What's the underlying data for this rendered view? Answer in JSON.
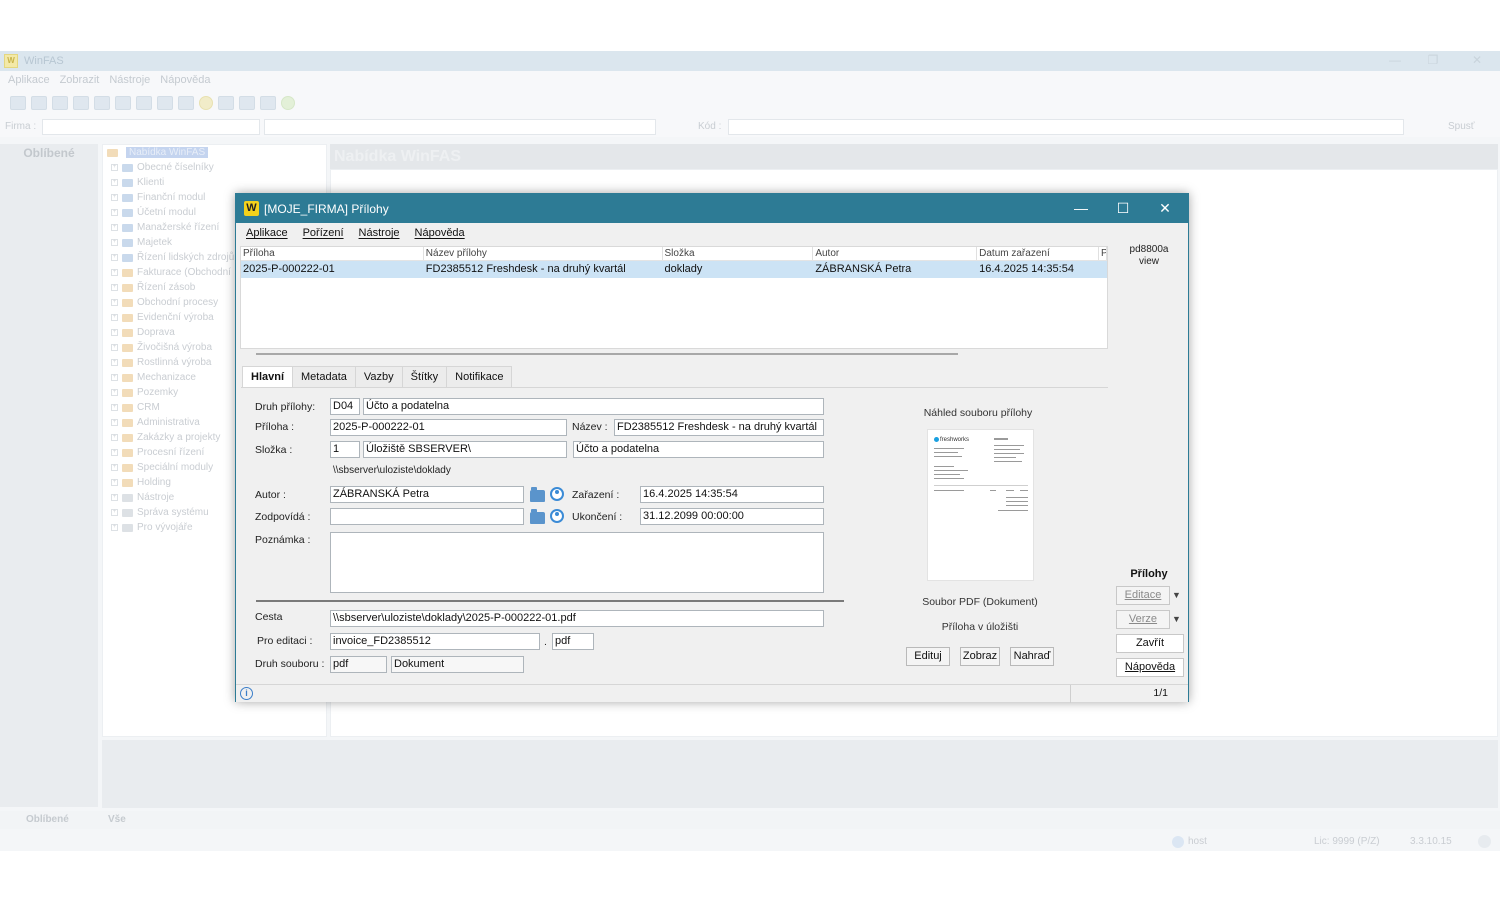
{
  "main_window": {
    "title": "WinFAS",
    "menu": [
      "Aplikace",
      "Zobrazit",
      "Nástroje",
      "Nápověda"
    ],
    "filter_label_firma": "Firma :",
    "filter_label_kod": "Kód :",
    "run_label": "Spusť",
    "sidebar_title": "Oblíbené",
    "tree_root": "Nabídka WinFAS",
    "tree_items": [
      {
        "label": "Obecné číselníky",
        "color": "blue"
      },
      {
        "label": "Klienti",
        "color": "blue"
      },
      {
        "label": "Finanční modul",
        "color": "blue"
      },
      {
        "label": "Účetní modul",
        "color": "blue"
      },
      {
        "label": "Manažerské řízení",
        "color": "blue"
      },
      {
        "label": "Majetek",
        "color": "blue"
      },
      {
        "label": "Řízení lidských zdrojů",
        "color": "blue"
      },
      {
        "label": "Fakturace (Obchodní",
        "color": "orange"
      },
      {
        "label": "Řízení zásob",
        "color": "orange"
      },
      {
        "label": "Obchodní procesy",
        "color": "orange"
      },
      {
        "label": "Evidenční výroba",
        "color": "orange"
      },
      {
        "label": "Doprava",
        "color": "orange"
      },
      {
        "label": "Živočišná výroba",
        "color": "orange"
      },
      {
        "label": "Rostlinná výroba",
        "color": "orange"
      },
      {
        "label": "Mechanizace",
        "color": "orange"
      },
      {
        "label": "Pozemky",
        "color": "orange"
      },
      {
        "label": "CRM",
        "color": "orange"
      },
      {
        "label": "Administrativa",
        "color": "orange"
      },
      {
        "label": "Zakázky a projekty",
        "color": "orange"
      },
      {
        "label": "Procesní řízení",
        "color": "orange"
      },
      {
        "label": "Speciální moduly",
        "color": "orange"
      },
      {
        "label": "Holding",
        "color": "orange"
      },
      {
        "label": "Nástroje",
        "color": "gray"
      },
      {
        "label": "Správa systému",
        "color": "gray"
      },
      {
        "label": "Pro vývojáře",
        "color": "gray"
      }
    ],
    "content_title": "Nabídka WinFAS",
    "bottom_tabs": [
      "Oblíbené",
      "Vše"
    ],
    "status_user": "host",
    "status_lic": "Lic: 9999 (P/Z)",
    "status_version": "3.3.10.15"
  },
  "dialog": {
    "title": "[MOJE_FIRMA] Přílohy",
    "menu": [
      "Aplikace",
      "Pořízení",
      "Nástroje",
      "Nápověda"
    ],
    "grid": {
      "columns": [
        "Příloha",
        "Název přílohy",
        "Složka",
        "Autor",
        "Datum zařazení",
        "P"
      ],
      "rows": [
        [
          "2025-P-000222-01",
          "FD2385512 Freshdesk - na druhý kvartál",
          "doklady",
          "ZÁBRANSKÁ Petra",
          "16.4.2025 14:35:54"
        ]
      ]
    },
    "view_label_1": "pd8800a",
    "view_label_2": "view",
    "tabs": [
      "Hlavní",
      "Metadata",
      "Vazby",
      "Štítky",
      "Notifikace"
    ],
    "form": {
      "druh_label": "Druh přílohy:",
      "druh_code": "D04",
      "druh_name": "Účto a podatelna",
      "priloha_label": "Příloha :",
      "priloha_value": "2025-P-000222-01",
      "nazev_label": "Název :",
      "nazev_value": "FD2385512 Freshdesk - na druhý kvartál",
      "slozka_label": "Složka :",
      "slozka_code": "1",
      "slozka_name": "Úložiště SBSERVER\\",
      "slozka_extra": "Účto a podatelna",
      "slozka_path": "\\\\sbserver\\uloziste\\doklady",
      "autor_label": "Autor :",
      "autor_value": "ZÁBRANSKÁ Petra",
      "zarazeni_label": "Zařazení :",
      "zarazeni_value": "16.4.2025 14:35:54",
      "zodpovida_label": "Zodpovídá :",
      "zodpovida_value": "",
      "ukonceni_label": "Ukončení :",
      "ukonceni_value": "31.12.2099 00:00:00",
      "poznamka_label": "Poznámka :",
      "poznamka_value": "",
      "cesta_label": "Cesta",
      "cesta_value": "\\\\sbserver\\uloziste\\doklady\\2025-P-000222-01.pdf",
      "pro_editaci_label": "Pro editaci :",
      "pro_editaci_value": "invoice_FD2385512",
      "pro_editaci_ext": "pdf",
      "druh_souboru_label": "Druh souboru :",
      "druh_souboru_code": "pdf",
      "druh_souboru_name": "Dokument"
    },
    "preview": {
      "title": "Náhled souboru přílohy",
      "logo_text": "freshworks",
      "caption_type": "Soubor PDF (Dokument)",
      "caption_location": "Příloha v úložišti",
      "btn_edit": "Edituj",
      "btn_show": "Zobraz",
      "btn_replace": "Nahraď"
    },
    "side": {
      "title": "Přílohy",
      "btn_editace": "Editace",
      "btn_verze": "Verze",
      "btn_zavrit": "Zavřít",
      "btn_napoveda": "Nápověda",
      "dropdown_glyph": "▼"
    },
    "status": {
      "info_glyph": "i",
      "page": "1/1"
    }
  }
}
